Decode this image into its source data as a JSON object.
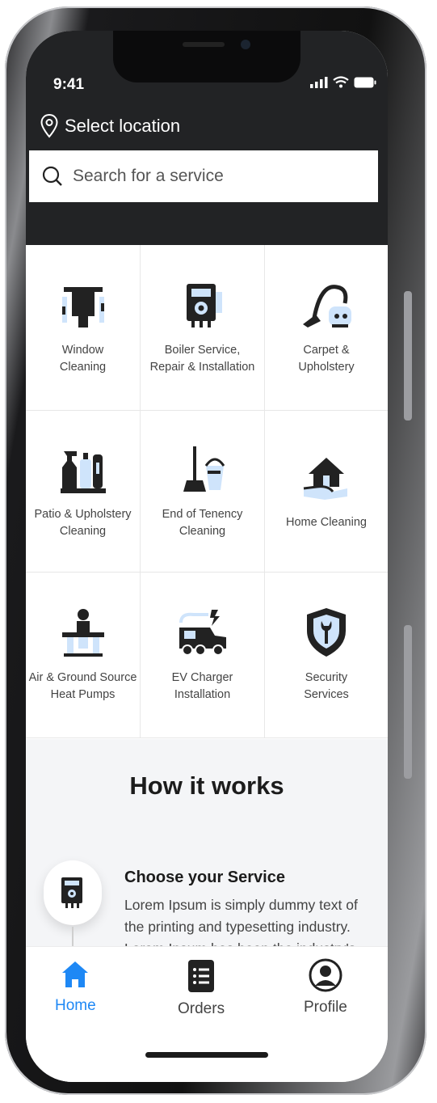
{
  "status": {
    "time": "9:41"
  },
  "header": {
    "location_label": "Select location",
    "search_placeholder": "Search for a service"
  },
  "services": [
    {
      "label_1": "Window",
      "label_2": "Cleaning",
      "icon": "window-cleaning-icon"
    },
    {
      "label_1": "Boiler Service,",
      "label_2": "Repair & Installation",
      "icon": "boiler-icon"
    },
    {
      "label_1": "Carpet &",
      "label_2": "Upholstery",
      "icon": "vacuum-icon"
    },
    {
      "label_1": "Patio & Upholstery",
      "label_2": "Cleaning",
      "icon": "cleaning-supplies-icon"
    },
    {
      "label_1": "End of Tenency",
      "label_2": "Cleaning",
      "icon": "broom-bucket-icon"
    },
    {
      "label_1": "Home Cleaning",
      "label_2": "",
      "icon": "house-hand-icon"
    },
    {
      "label_1": "Air & Ground Source",
      "label_2": "Heat Pumps",
      "icon": "heat-pump-icon"
    },
    {
      "label_1": "EV Charger",
      "label_2": "Installation",
      "icon": "ev-charger-icon"
    },
    {
      "label_1": "Security",
      "label_2": "Services",
      "icon": "shield-wrench-icon"
    }
  ],
  "how_it_works": {
    "title": "How it works",
    "step_title": "Choose your Service",
    "step_desc": "Lorem Ipsum is simply dummy text of the printing and typesetting industry. Lorem Ipsum has been the industry's standard"
  },
  "nav": {
    "home": "Home",
    "orders": "Orders",
    "profile": "Profile"
  },
  "colors": {
    "accent": "#1e88f5",
    "dark": "#222325",
    "icon_fill": "#cfe4fb"
  }
}
